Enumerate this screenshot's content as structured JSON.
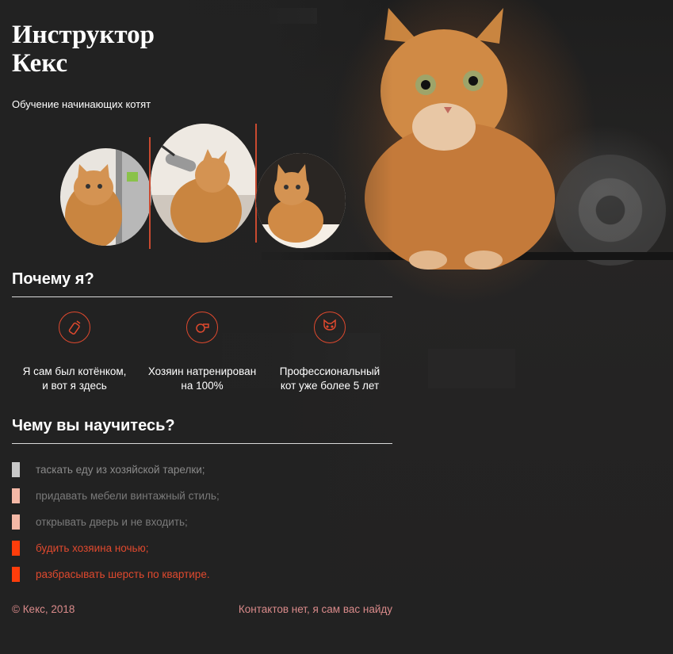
{
  "header": {
    "title_line1": "Инструктор",
    "title_line2": "Кекс",
    "subtitle": "Обучение начинающих котят"
  },
  "why": {
    "heading": "Почему я?",
    "features": [
      {
        "icon": "bottle-icon",
        "line1": "Я сам был котёнком,",
        "line2": "и вот я здесь"
      },
      {
        "icon": "whistle-icon",
        "line1": "Хозяин натренирован",
        "line2": "на 100%"
      },
      {
        "icon": "cat-face-icon",
        "line1": "Профессиональный",
        "line2": "кот уже более 5 лет"
      }
    ]
  },
  "learn": {
    "heading": "Чему вы научитесь?",
    "items": [
      {
        "text": "таскать еду из хозяйской тарелки;",
        "marker_color": "#c8c8c8",
        "text_color": "#8a8a8a"
      },
      {
        "text": "придавать мебели винтажный стиль;",
        "marker_color": "#f4b8a6",
        "text_color": "#7a7a7a"
      },
      {
        "text": "открывать дверь и не входить;",
        "marker_color": "#f4b8a6",
        "text_color": "#7a7a7a"
      },
      {
        "text": "будить хозяина ночью;",
        "marker_color": "#ff3d0b",
        "text_color": "#e0492e"
      },
      {
        "text": "разбрасывать шерсть по квартире.",
        "marker_color": "#ff3d0b",
        "text_color": "#e0492e"
      }
    ]
  },
  "footer": {
    "copyright": "© Кекс, 2018",
    "contacts": "Контактов нет, я сам вас найду"
  },
  "colors": {
    "accent": "#e0492e",
    "background": "#222222"
  }
}
